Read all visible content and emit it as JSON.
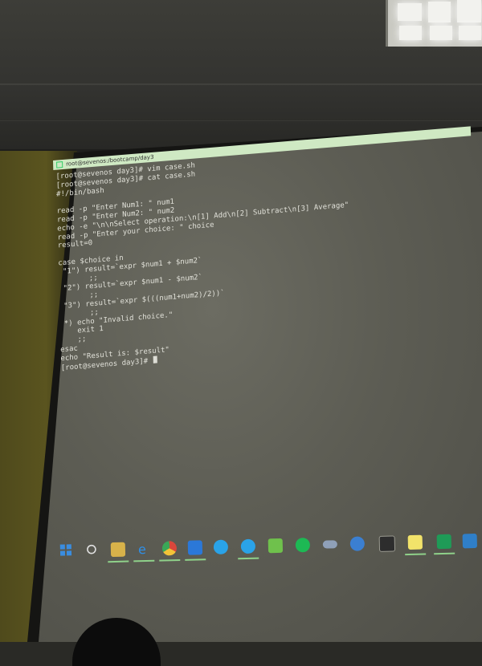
{
  "terminal": {
    "title": "root@sevenos:/bootcamp/day3",
    "lines": [
      "[root@sevenos day3]# vim case.sh",
      "[root@sevenos day3]# cat case.sh",
      "#!/bin/bash",
      "",
      "read -p \"Enter Num1: \" num1",
      "read -p \"Enter Num2: \" num2",
      "echo -e \"\\n\\nSelect operation:\\n[1] Add\\n[2] Subtract\\n[3] Average\"",
      "read -p \"Enter your choice: \" choice",
      "result=0",
      "",
      "case $choice in",
      " \"1\") result=`expr $num1 + $num2`",
      "       ;;",
      " \"2\") result=`expr $num1 - $num2`",
      "       ;;",
      " \"3\") result=`expr $(((num1+num2)/2))`",
      "       ;;",
      " *) echo \"Invalid choice.\"",
      "    exit 1",
      "    ;;",
      "esac",
      "echo \"Result is: $result\"",
      "[root@sevenos day3]# "
    ]
  },
  "taskbar": {
    "icons": [
      {
        "name": "start-icon",
        "color": "#3a8de0"
      },
      {
        "name": "search-icon",
        "color": "#e0e0e0"
      },
      {
        "name": "file-explorer-icon",
        "color": "#d8b24a"
      },
      {
        "name": "edge-icon",
        "color": "#2f8fe6"
      },
      {
        "name": "chrome-icon",
        "color": "#d9473b"
      },
      {
        "name": "outlook-icon",
        "color": "#2b78d8"
      },
      {
        "name": "skype-icon",
        "color": "#2aa3e8"
      },
      {
        "name": "skype-business-icon",
        "color": "#2aa3e8"
      },
      {
        "name": "notepad-plus-icon",
        "color": "#6fc14c"
      },
      {
        "name": "spotify-icon",
        "color": "#1db954"
      },
      {
        "name": "cloud-app-icon",
        "color": "#8fa0b8"
      },
      {
        "name": "lock-app-icon",
        "color": "#3b7fd1"
      },
      {
        "name": "terminal-icon",
        "color": "#2d2d2d"
      },
      {
        "name": "sticky-notes-icon",
        "color": "#f2e36a"
      },
      {
        "name": "excel-icon",
        "color": "#1f9b57"
      },
      {
        "name": "network-app-icon",
        "color": "#2f7fc8"
      }
    ]
  }
}
